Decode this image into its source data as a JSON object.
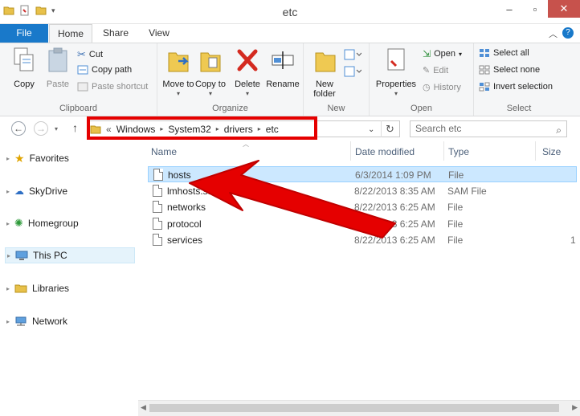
{
  "window": {
    "title": "etc"
  },
  "ribbon_tabs": [
    "File",
    "Home",
    "Share",
    "View"
  ],
  "clipboard": {
    "copy": "Copy",
    "paste": "Paste",
    "cut": "Cut",
    "copy_path": "Copy path",
    "paste_shortcut": "Paste shortcut",
    "label": "Clipboard"
  },
  "organize": {
    "move_to": "Move to",
    "copy_to": "Copy to",
    "delete": "Delete",
    "rename": "Rename",
    "label": "Organize"
  },
  "new": {
    "new_folder": "New folder",
    "label": "New"
  },
  "open": {
    "properties": "Properties",
    "open": "Open",
    "edit": "Edit",
    "history": "History",
    "label": "Open"
  },
  "select": {
    "select_all": "Select all",
    "select_none": "Select none",
    "invert_selection": "Invert selection",
    "label": "Select"
  },
  "address": {
    "prefix": "«",
    "crumbs": [
      "Windows",
      "System32",
      "drivers",
      "etc"
    ]
  },
  "search": {
    "placeholder": "Search etc"
  },
  "nav": {
    "items": [
      "Favorites",
      "SkyDrive",
      "Homegroup",
      "This PC",
      "Libraries",
      "Network"
    ]
  },
  "columns": {
    "name": "Name",
    "date": "Date modified",
    "type": "Type",
    "size": "Size"
  },
  "files": [
    {
      "name": "hosts",
      "date": "6/3/2014 1:09 PM",
      "type": "File",
      "size": ""
    },
    {
      "name": "lmhosts.sam",
      "date": "8/22/2013 8:35 AM",
      "type": "SAM File",
      "size": ""
    },
    {
      "name": "networks",
      "date": "8/22/2013 6:25 AM",
      "type": "File",
      "size": ""
    },
    {
      "name": "protocol",
      "date": "8/22/2013 6:25 AM",
      "type": "File",
      "size": ""
    },
    {
      "name": "services",
      "date": "8/22/2013 6:25 AM",
      "type": "File",
      "size": "1"
    }
  ],
  "colors": {
    "accent": "#1979ca",
    "highlight": "#e50000",
    "selection": "#cce8ff"
  }
}
